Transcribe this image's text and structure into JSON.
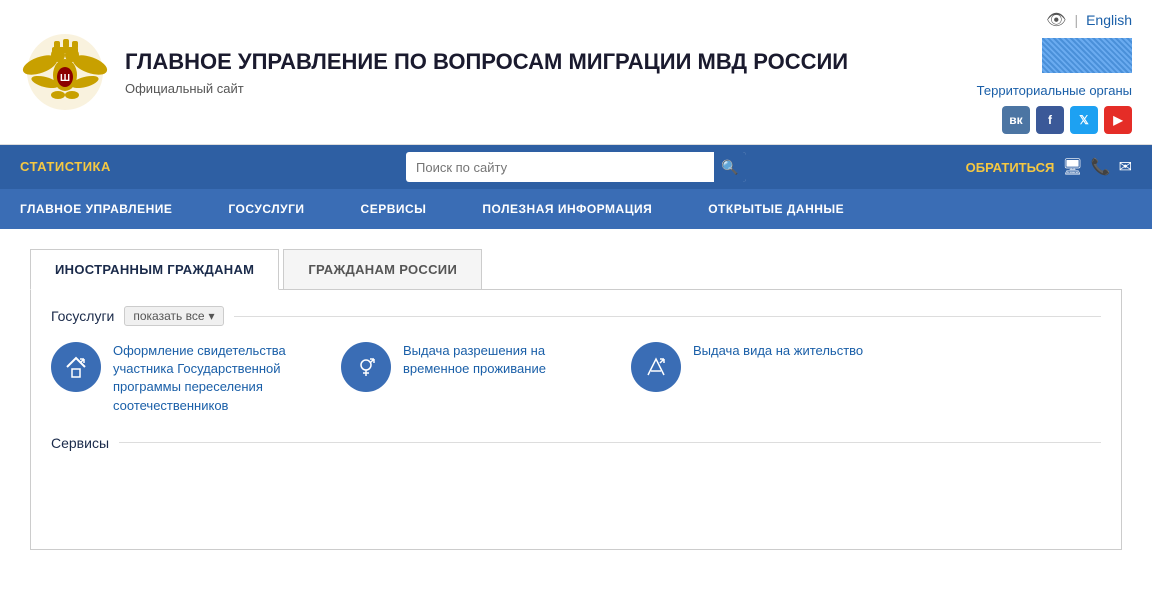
{
  "header": {
    "title": "ГЛАВНОЕ УПРАВЛЕНИЕ ПО ВОПРОСАМ МИГРАЦИИ МВД РОССИИ",
    "subtitle": "Официальный сайт",
    "lang_text": "English",
    "territorial_link": "Территориальные органы"
  },
  "nav_top": {
    "statistics_label": "СТАТИСТИКА",
    "search_placeholder": "Поиск по сайту",
    "contact_label": "ОБРАТИТЬСЯ"
  },
  "nav_main": {
    "items": [
      "ГЛАВНОЕ УПРАВЛЕНИЕ",
      "ГОСУСЛУГИ",
      "СЕРВИСЫ",
      "ПОЛЕЗНАЯ ИНФОРМАЦИЯ",
      "ОТКРЫТЫЕ ДАННЫЕ"
    ]
  },
  "tabs": [
    {
      "label": "ИНОСТРАННЫМ ГРАЖДАНАМ",
      "active": true
    },
    {
      "label": "ГРАЖДАНАМ РОССИИ",
      "active": false
    }
  ],
  "gosuslugi": {
    "title": "Госуслуги",
    "show_all": "показать все",
    "services": [
      {
        "text": "Оформление свидетельства участника Государственной программы переселения соотечественников"
      },
      {
        "text": "Выдача разрешения на временное проживание"
      },
      {
        "text": "Выдача вида на жительство"
      }
    ]
  },
  "services_section": {
    "title": "Сервисы"
  },
  "social": {
    "items": [
      {
        "name": "VK",
        "label": "ВК"
      },
      {
        "name": "Facebook",
        "label": "f"
      },
      {
        "name": "Twitter",
        "label": "t"
      },
      {
        "name": "YouTube",
        "label": "▶"
      }
    ]
  }
}
